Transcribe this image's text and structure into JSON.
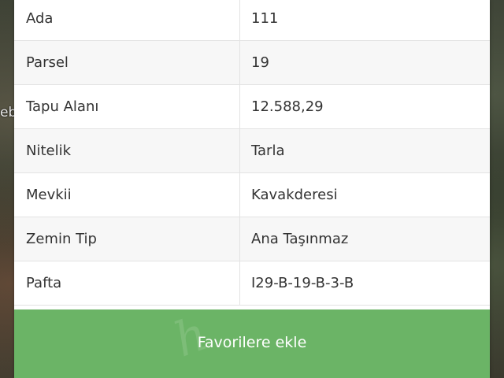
{
  "map": {
    "edge_label": "eb"
  },
  "parcel_info": {
    "rows": [
      {
        "label": "Ada",
        "value": "111"
      },
      {
        "label": "Parsel",
        "value": "19"
      },
      {
        "label": "Tapu Alanı",
        "value": "12.588,29"
      },
      {
        "label": "Nitelik",
        "value": "Tarla"
      },
      {
        "label": "Mevkii",
        "value": "Kavakderesi"
      },
      {
        "label": "Zemin Tip",
        "value": "Ana Taşınmaz"
      },
      {
        "label": "Pafta",
        "value": "I29-B-19-B-3-B"
      }
    ]
  },
  "actions": {
    "favorite_label": "Favorilere ekle"
  },
  "colors": {
    "button_green": "#6bb466",
    "text": "#333333"
  }
}
